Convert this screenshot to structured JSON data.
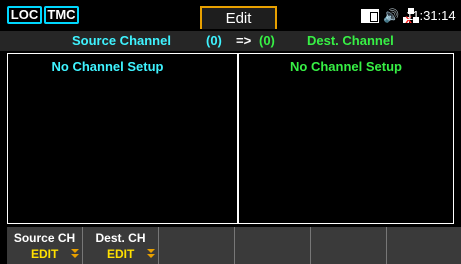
{
  "topbar": {
    "loc": "LOC",
    "tmc": "TMC",
    "mode": "Edit",
    "speaker_glyph": "🔊",
    "clock": "11:31:14"
  },
  "header": {
    "source_label": "Source Channel",
    "source_count": "(0)",
    "arrow": "=>",
    "dest_count": "(0)",
    "dest_label": "Dest. Channel"
  },
  "panels": {
    "source_message": "No Channel Setup",
    "dest_message": "No Channel Setup"
  },
  "softkeys": [
    {
      "label": "Source CH",
      "sub": "EDIT"
    },
    {
      "label": "Dest. CH",
      "sub": "EDIT"
    },
    {
      "label": "",
      "sub": ""
    },
    {
      "label": "",
      "sub": ""
    },
    {
      "label": "",
      "sub": ""
    },
    {
      "label": "",
      "sub": ""
    }
  ],
  "colors": {
    "source": "#3ff3ff",
    "dest": "#37f045",
    "accent": "#e8a000",
    "softkey_sub": "#ffe000"
  },
  "icons": [
    "display-icon",
    "speaker-icon",
    "network-disconnected-icon",
    "chevron-down-double-icon"
  ]
}
